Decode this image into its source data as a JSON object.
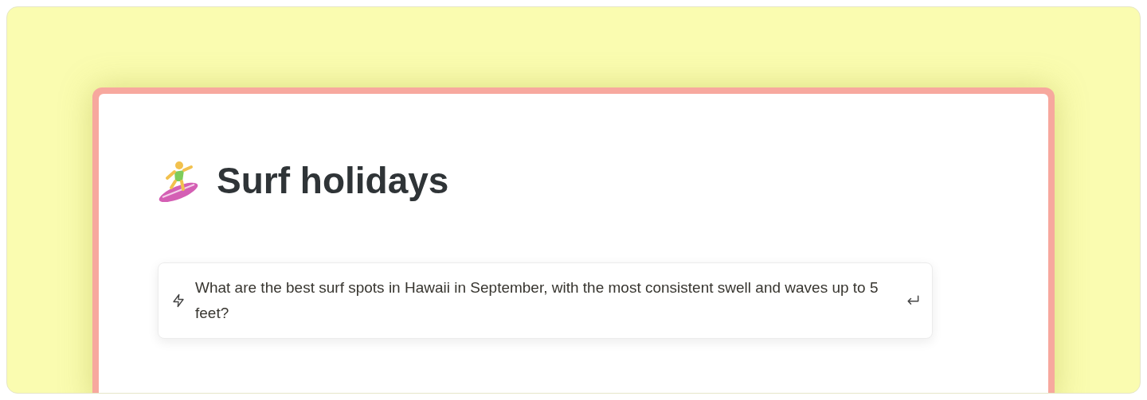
{
  "page": {
    "title": "Surf holidays"
  },
  "prompt": {
    "text": "What are the best surf spots in Hawaii in September, with the most consistent swell and waves up to 5 feet?"
  }
}
